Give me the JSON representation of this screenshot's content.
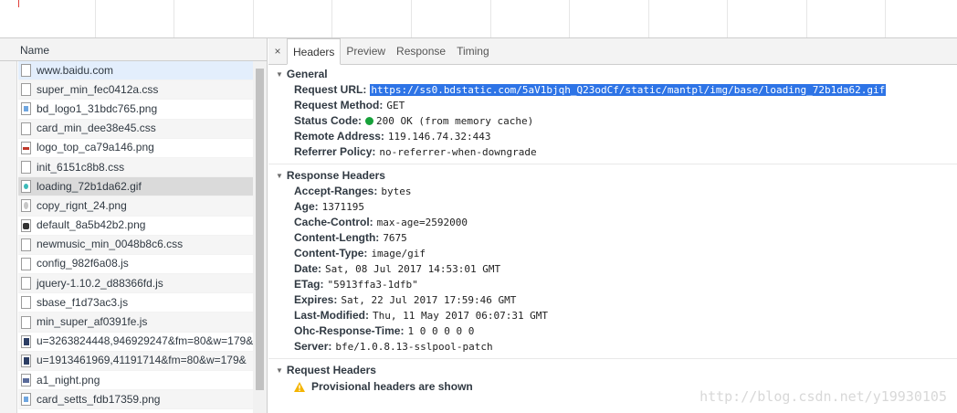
{
  "list": {
    "header": "Name",
    "requests": [
      {
        "name": "www.baidu.com",
        "icon": "document-icon"
      },
      {
        "name": "super_min_fec0412a.css",
        "icon": "css-file-icon"
      },
      {
        "name": "bd_logo1_31bdc765.png",
        "icon": "image-file-icon"
      },
      {
        "name": "card_min_dee38e45.css",
        "icon": "css-file-icon"
      },
      {
        "name": "logo_top_ca79a146.png",
        "icon": "image-file-icon"
      },
      {
        "name": "init_6151c8b8.css",
        "icon": "css-file-icon"
      },
      {
        "name": "loading_72b1da62.gif",
        "icon": "gif-file-icon"
      },
      {
        "name": "copy_rignt_24.png",
        "icon": "image-file-icon"
      },
      {
        "name": "default_8a5b42b2.png",
        "icon": "image-file-icon"
      },
      {
        "name": "newmusic_min_0048b8c6.css",
        "icon": "css-file-icon"
      },
      {
        "name": "config_982f6a08.js",
        "icon": "script-file-icon"
      },
      {
        "name": "jquery-1.10.2_d88366fd.js",
        "icon": "script-file-icon"
      },
      {
        "name": "sbase_f1d73ac3.js",
        "icon": "script-file-icon"
      },
      {
        "name": "min_super_af0391fe.js",
        "icon": "script-file-icon"
      },
      {
        "name": "u=3263824448,946929247&fm=80&w=179&",
        "icon": "image-file-icon"
      },
      {
        "name": "u=1913461969,41191714&fm=80&w=179&",
        "icon": "image-file-icon"
      },
      {
        "name": "a1_night.png",
        "icon": "image-file-icon"
      },
      {
        "name": "card_setts_fdb17359.png",
        "icon": "image-file-icon"
      }
    ]
  },
  "tabs": {
    "close": "×",
    "items": [
      "Headers",
      "Preview",
      "Response",
      "Timing"
    ],
    "active": "Headers"
  },
  "general": {
    "title": "General",
    "request_url_label": "Request URL:",
    "request_url": "https://ss0.bdstatic.com/5aV1bjqh_Q23odCf/static/mantpl/img/base/loading_72b1da62.gif",
    "request_method_label": "Request Method:",
    "request_method": "GET",
    "status_code_label": "Status Code:",
    "status_code": "200 OK (from memory cache)",
    "status_color": "#17a13a",
    "remote_address_label": "Remote Address:",
    "remote_address": "119.146.74.32:443",
    "referrer_policy_label": "Referrer Policy:",
    "referrer_policy": "no-referrer-when-downgrade"
  },
  "response_headers": {
    "title": "Response Headers",
    "items": [
      {
        "k": "Accept-Ranges:",
        "v": "bytes"
      },
      {
        "k": "Age:",
        "v": "1371195"
      },
      {
        "k": "Cache-Control:",
        "v": "max-age=2592000"
      },
      {
        "k": "Content-Length:",
        "v": "7675"
      },
      {
        "k": "Content-Type:",
        "v": "image/gif"
      },
      {
        "k": "Date:",
        "v": "Sat, 08 Jul 2017 14:53:01 GMT"
      },
      {
        "k": "ETag:",
        "v": "\"5913ffa3-1dfb\""
      },
      {
        "k": "Expires:",
        "v": "Sat, 22 Jul 2017 17:59:46 GMT"
      },
      {
        "k": "Last-Modified:",
        "v": "Thu, 11 May 2017 06:07:31 GMT"
      },
      {
        "k": "Ohc-Response-Time:",
        "v": "1 0 0 0 0 0"
      },
      {
        "k": "Server:",
        "v": "bfe/1.0.8.13-sslpool-patch"
      }
    ]
  },
  "request_headers": {
    "title": "Request Headers",
    "warning": "Provisional headers are shown"
  },
  "watermark": "http://blog.csdn.net/y19930105"
}
